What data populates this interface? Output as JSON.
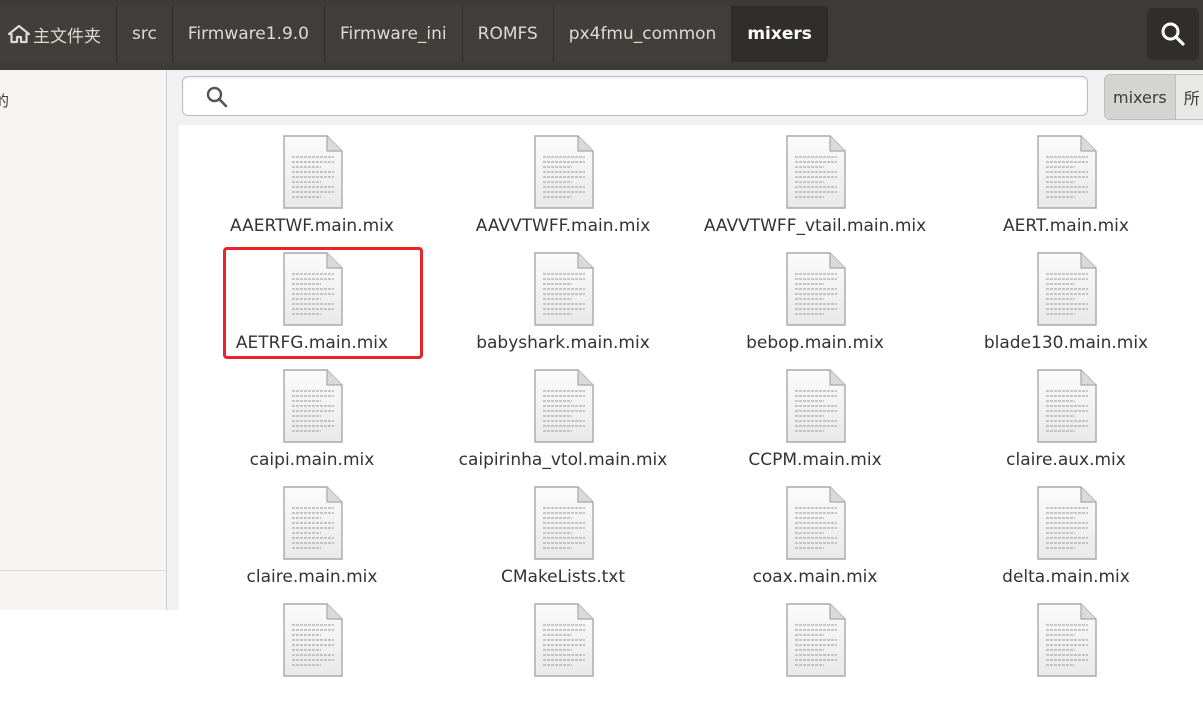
{
  "breadcrumb": {
    "items": [
      {
        "label": "主文件夹",
        "icon": "home-icon"
      },
      {
        "label": "src"
      },
      {
        "label": "Firmware1.9.0"
      },
      {
        "label": "Firmware_ini"
      },
      {
        "label": "ROMFS"
      },
      {
        "label": "px4fmu_common"
      },
      {
        "label": "mixers"
      }
    ]
  },
  "header": {
    "search_icon": "search-icon"
  },
  "sidebar": {
    "items": [
      {
        "label": "的"
      }
    ]
  },
  "search": {
    "value": "",
    "placeholder": ""
  },
  "scope": {
    "current": "mixers",
    "all": "所"
  },
  "files": [
    "AAERTWF.main.mix",
    "AAVVTWFF.main.mix",
    "AAVVTWFF_vtail.main.mix",
    "AERT.main.mix",
    "AETRFG.main.mix",
    "babyshark.main.mix",
    "bebop.main.mix",
    "blade130.main.mix",
    "caipi.main.mix",
    "caipirinha_vtol.main.mix",
    "CCPM.main.mix",
    "claire.aux.mix",
    "claire.main.mix",
    "CMakeLists.txt",
    "coax.main.mix",
    "delta.main.mix",
    "",
    "",
    "",
    ""
  ],
  "colors": {
    "header_bg": "#3c3b37",
    "highlight_box": "#e8232a"
  }
}
